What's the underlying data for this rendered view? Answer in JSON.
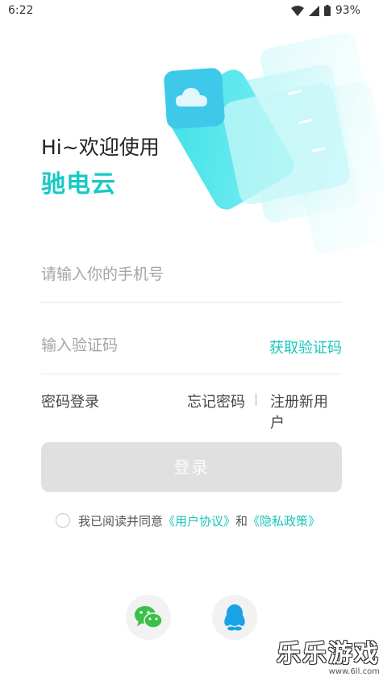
{
  "status_bar": {
    "time": "6:22",
    "battery": "93%"
  },
  "greeting": "Hi~欢迎使用",
  "brand": "驰电云",
  "phone": {
    "placeholder": "请输入你的手机号",
    "value": ""
  },
  "code": {
    "placeholder": "输入验证码",
    "value": "",
    "get_code_label": "获取验证码"
  },
  "links": {
    "password_login": "密码登录",
    "forgot_password": "忘记密码",
    "separator": "|",
    "register": "注册新用户"
  },
  "login_button": "登录",
  "agreement": {
    "text": "我已阅读并同意",
    "user_agreement": "《用户协议》",
    "and": "和",
    "privacy_policy": "《隐私政策》",
    "checked": false
  },
  "social": [
    {
      "name": "wechat",
      "icon": "wechat-icon"
    },
    {
      "name": "qq",
      "icon": "qq-icon"
    }
  ],
  "watermark": {
    "text": "乐乐游戏",
    "url": "www.6ll.com"
  },
  "colors": {
    "accent": "#1cc6bb",
    "button_disabled": "#e0e0e0"
  }
}
